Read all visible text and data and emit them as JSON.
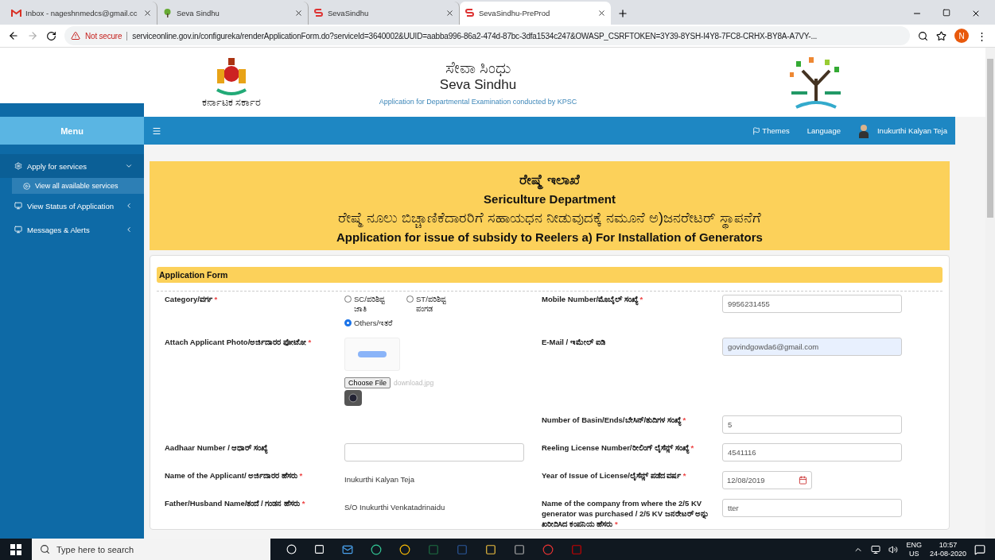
{
  "browser": {
    "tabs": [
      {
        "label": "Inbox - nageshnmedcs@gmail.cc",
        "kind": "mail",
        "selected": false
      },
      {
        "label": "Seva Sindhu",
        "kind": "tree",
        "selected": false
      },
      {
        "label": "SevaSindhu",
        "kind": "ss",
        "selected": false
      },
      {
        "label": "SevaSindhu-PreProd",
        "kind": "ss",
        "selected": true
      }
    ],
    "security": "Not secure",
    "url": "serviceonline.gov.in/configureka/renderApplicationForm.do?serviceId=3640002&UUID=aabba996-86a2-474d-87bc-3dfa1534c247&OWASP_CSRFTOKEN=3Y39-8YSH-I4Y8-7FC8-CRHX-BY8A-A7VY-...",
    "profile_initial": "N",
    "menu": "⋮"
  },
  "header": {
    "emblem_caption": "ಕರ್ನಾಟಕ ಸರ್ಕಾರ",
    "title_kn": "ಸೇವಾ ಸಿಂಧು",
    "title_en": "Seva Sindhu",
    "subtitle": "Application for Departmental Examination conducted by KPSC"
  },
  "sidebar": {
    "title": "Menu",
    "items": [
      {
        "label": "Apply for services",
        "expanded": true,
        "children": [
          {
            "label": "View all available services",
            "selected": true
          }
        ]
      },
      {
        "label": "View Status of Application",
        "expanded": false
      },
      {
        "label": "Messages & Alerts",
        "expanded": false
      }
    ]
  },
  "topbar": {
    "themes": "Themes",
    "language": "Language",
    "user": "Inukurthi Kalyan Teja"
  },
  "banner": {
    "department_kn": "ರೇಷ್ಮೆ ಇಲಾಖೆ",
    "department_en": "Sericulture Department",
    "title_kn": "ರೇಷ್ಮೆ ನೂಲು ಬಿಚ್ಚಾಣಿಕೆದಾರರಿಗೆ ಸಹಾಯಧನ ನೀಡುವುದಕ್ಕೆ ನಮೂನೆ ಅ)ಜನರೇಟರ್ ಸ್ಥಾಪನೆಗೆ",
    "title_en": "Application for issue of subsidy to Reelers a) For Installation of Generators"
  },
  "form": {
    "title": "Application Form",
    "rows": [
      {
        "left": {
          "label": "Category/ವರ್ಗ",
          "required": "*",
          "kind": "radio",
          "options": [
            {
              "label": "SC/ಪರಿಶಿಷ್ಟ ಜಾತಿ",
              "selected": false
            },
            {
              "label": "ST/ಪರಿಶಿಷ್ಟ ಪಂಗಡ",
              "selected": false
            },
            {
              "label": "Others/ಇತರೆ",
              "selected": true
            }
          ]
        },
        "right": {
          "label": "Mobile Number/ಮೊಬೈಲ್ ಸಂಖ್ಯೆ",
          "required": "*",
          "kind": "input",
          "value": "9956231455",
          "autofilled": false
        }
      },
      {
        "left": {
          "label": "Attach Applicant Photo/ಅರ್ಜಿದಾರರ ಫೋಟೋ",
          "required": "*",
          "kind": "photo",
          "button": "Choose File",
          "file": "download.jpg"
        },
        "right": {
          "label": "E-Mail / ಇಮೇಲ್ ಐಡಿ",
          "kind": "input",
          "value": "govindgowda6@gmail.com",
          "autofilled": true
        }
      },
      {
        "right": {
          "label": "Number of Basin/Ends/ಬೇಸಿನ್/ತುದಿಗಳ ಸಂಖ್ಯೆ",
          "required": "*",
          "kind": "input",
          "value": "5",
          "autofilled": false
        }
      },
      {
        "left": {
          "label": "Aadhaar Number / ಆಧಾರ್ ಸಂಖ್ಯೆ",
          "kind": "input",
          "autofilled": false
        },
        "right": {
          "label": "Reeling License Number/ರೀಲಿಂಗ್ ಲೈಸೆನ್ಸ್ ಸಂಖ್ಯೆ",
          "required": "*",
          "kind": "input",
          "value": "4541116",
          "autofilled": false
        }
      },
      {
        "left": {
          "label": "Name of the Applicant/ ಅರ್ಜಿದಾರರ ಹೆಸರು",
          "required": "*",
          "kind": "text",
          "value": "Inukurthi Kalyan Teja"
        },
        "right": {
          "label": "Year of Issue of License/ಲೈಸೆನ್ಸ್ ಪಡೆದ ವರ್ಷ",
          "required": "*",
          "kind": "date",
          "value": "12/08/2019"
        }
      },
      {
        "left": {
          "label": "Father/Husband Name/ತಂದೆ / ಗಂಡನ ಹೆಸರು",
          "required": "*",
          "kind": "text",
          "value": "S/O Inukurthi Venkatadrinaidu"
        },
        "right": {
          "label": "Name of the company from where the 2/5 KV generator was purchased / 2/5 KV ಜನರೇಟರ್ ಅನ್ನು ಖರೀದಿಸಿದ ಕಂಪನಿಯ ಹೆಸರು",
          "required": "*",
          "kind": "input",
          "value": "tter",
          "autofilled": false
        }
      }
    ]
  },
  "taskbar": {
    "search_placeholder": "Type here to search",
    "lang": "ENG",
    "region": "US",
    "time": "10:57",
    "date": "24-08-2020"
  }
}
